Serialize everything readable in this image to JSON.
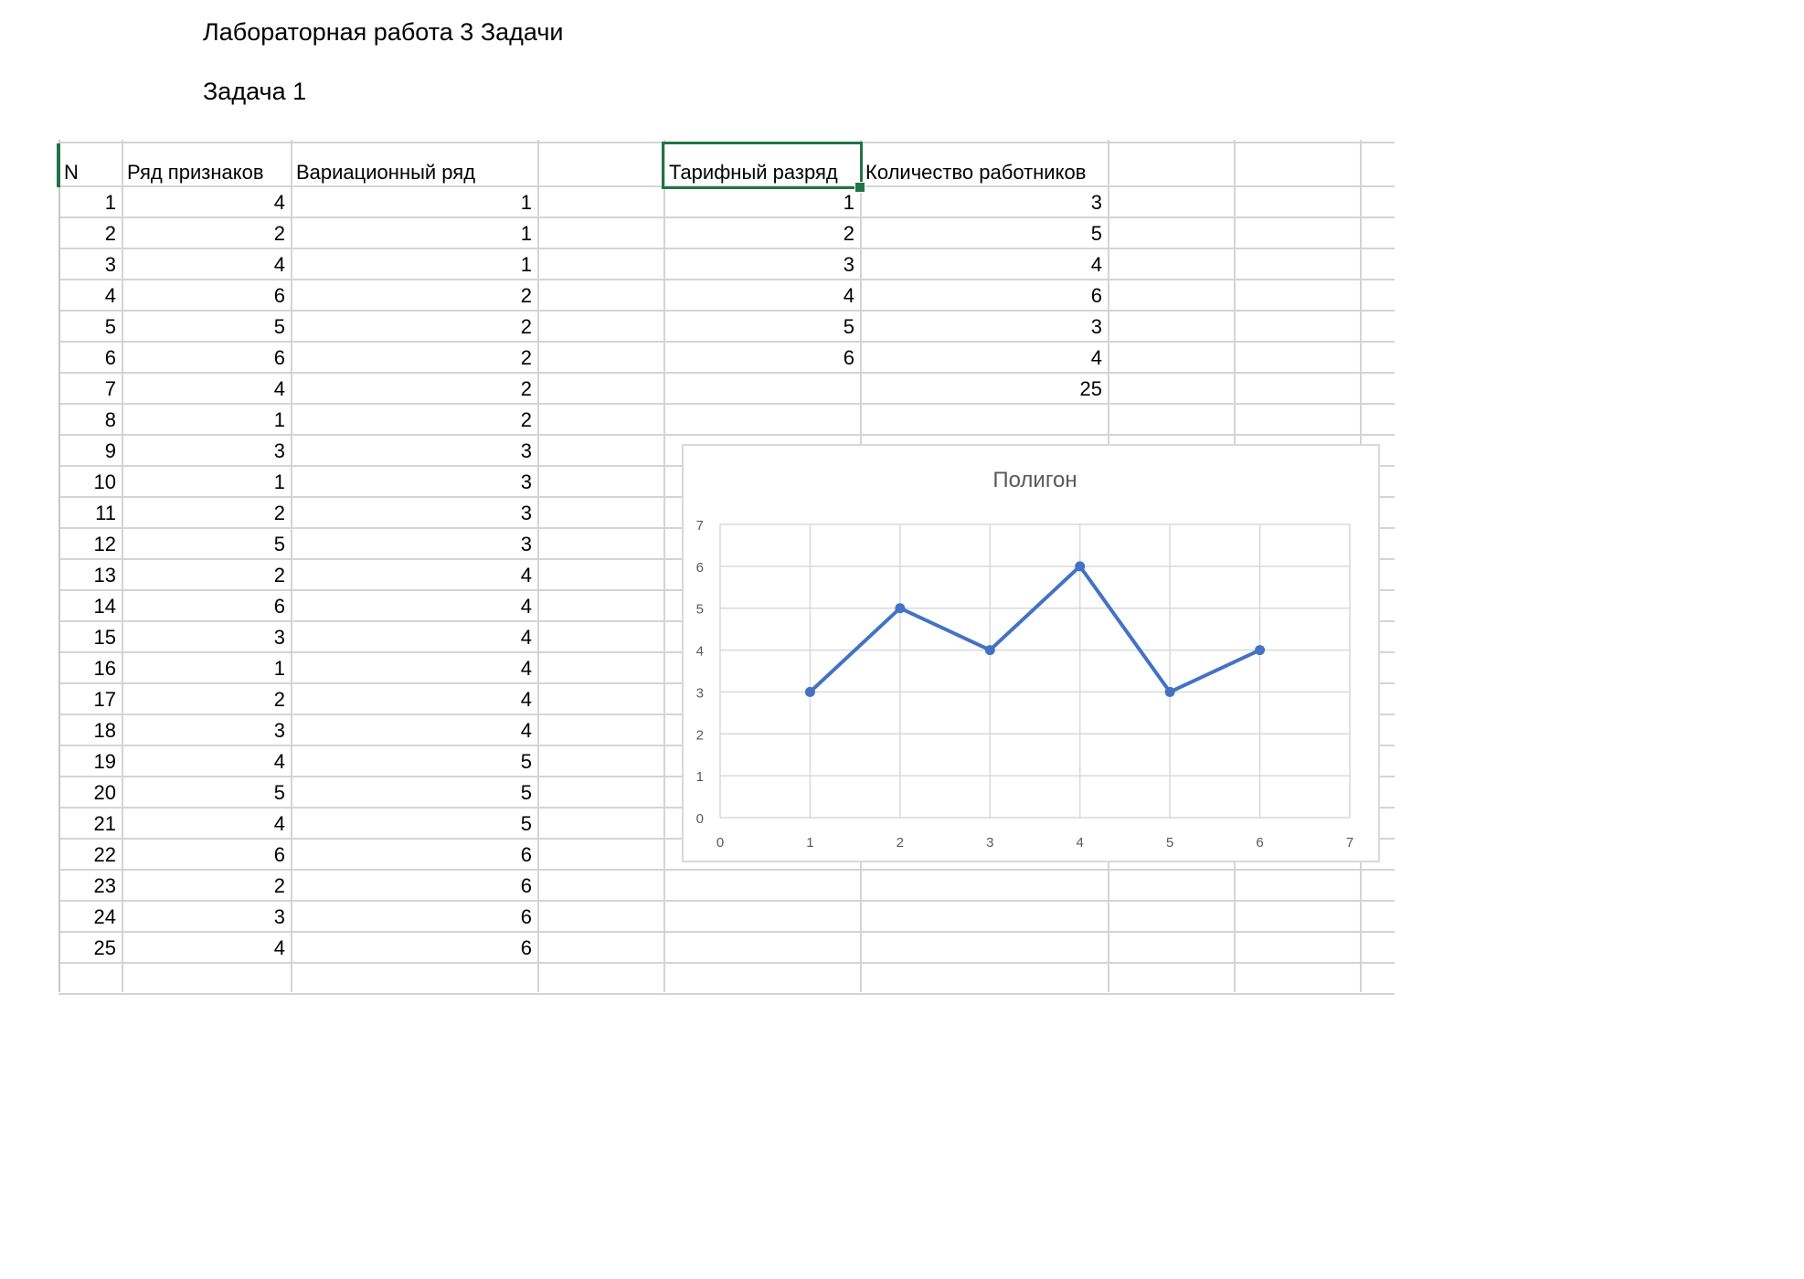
{
  "document": {
    "title": "Лабораторная работа 3 Задачи",
    "subtitle": "Задача 1"
  },
  "table1": {
    "headers": [
      "N",
      "Ряд признаков",
      "Вариационный ряд"
    ],
    "rows": [
      [
        1,
        4,
        1
      ],
      [
        2,
        2,
        1
      ],
      [
        3,
        4,
        1
      ],
      [
        4,
        6,
        2
      ],
      [
        5,
        5,
        2
      ],
      [
        6,
        6,
        2
      ],
      [
        7,
        4,
        2
      ],
      [
        8,
        1,
        2
      ],
      [
        9,
        3,
        3
      ],
      [
        10,
        1,
        3
      ],
      [
        11,
        2,
        3
      ],
      [
        12,
        5,
        3
      ],
      [
        13,
        2,
        4
      ],
      [
        14,
        6,
        4
      ],
      [
        15,
        3,
        4
      ],
      [
        16,
        1,
        4
      ],
      [
        17,
        2,
        4
      ],
      [
        18,
        3,
        4
      ],
      [
        19,
        4,
        5
      ],
      [
        20,
        5,
        5
      ],
      [
        21,
        4,
        5
      ],
      [
        22,
        6,
        6
      ],
      [
        23,
        2,
        6
      ],
      [
        24,
        3,
        6
      ],
      [
        25,
        4,
        6
      ]
    ]
  },
  "table2": {
    "headers": [
      "Тарифный разряд",
      "Количество работников"
    ],
    "rows": [
      [
        1,
        3
      ],
      [
        2,
        5
      ],
      [
        3,
        4
      ],
      [
        4,
        6
      ],
      [
        5,
        3
      ],
      [
        6,
        4
      ]
    ],
    "total": 25
  },
  "colors": {
    "series": "#4472C4",
    "selection": "#217346",
    "gridline": "#d4d4d4",
    "chart_grid": "#d9d9d9",
    "chart_text": "#595959"
  },
  "chart_data": {
    "type": "scatter",
    "title": "Полигон",
    "x": [
      1,
      2,
      3,
      4,
      5,
      6
    ],
    "y": [
      3,
      5,
      4,
      6,
      3,
      4
    ],
    "xlim": [
      0,
      7
    ],
    "ylim": [
      0,
      7
    ],
    "x_ticks": [
      0,
      1,
      2,
      3,
      4,
      5,
      6,
      7
    ],
    "y_ticks": [
      0,
      1,
      2,
      3,
      4,
      5,
      6,
      7
    ],
    "lines_connected": true,
    "markers": true,
    "grid": true,
    "legend": "none"
  }
}
